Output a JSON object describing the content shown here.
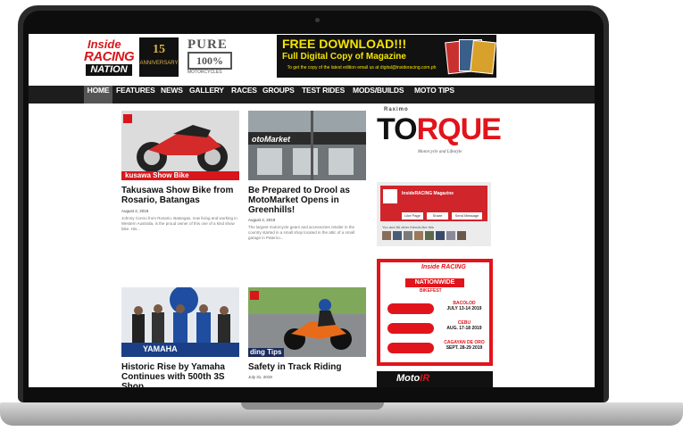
{
  "logo": {
    "line1": "Inside",
    "line2": "RACING",
    "line3": "NATION"
  },
  "anniversary": {
    "number": "15",
    "text": "ANNIVERSARY"
  },
  "pure": {
    "word": "PURE",
    "percent": "100%",
    "tagline": "MOTORCYCLES"
  },
  "banner": {
    "headline": "FREE DOWNLOAD!!!",
    "subline": "Full Digital Copy of Magazine",
    "note": "To get the copy of the latest edition email us at digital@insideracing.com.ph"
  },
  "nav": {
    "items": [
      "HOME",
      "FEATURES",
      "NEWS",
      "GALLERY",
      "RACES",
      "GROUPS",
      "TEST RIDES",
      "MODS/BUILDS",
      "MOTO TIPS"
    ],
    "active": "HOME"
  },
  "articles": [
    {
      "thumb_caption": "kusawa Show Bike",
      "title": "Takusawa Show Bike from Rosario, Batangas",
      "date": "August 2, 2019",
      "excerpt": "Johnny Corcio from Rosario, Batangas, now living and working in Western Australia, is the proud owner of this one of a kind show bike. His..."
    },
    {
      "thumb_caption": "otoMarket",
      "title": "Be Prepared to Drool as MotoMarket Opens in Greenhills!",
      "date": "August 2, 2019",
      "excerpt": "The largest motorcycle gears and accessories retailer in the country started in a small shop located in the attic of a small garage in Paterno..."
    },
    {
      "thumb_caption": "YAMAHA",
      "title": "Historic Rise by Yamaha Continues with 500th 3S Shop",
      "date": "",
      "excerpt": ""
    },
    {
      "thumb_caption": "ding Tips",
      "title": "Safety in Track Riding",
      "date": "July 31, 2019",
      "excerpt": ""
    }
  ],
  "sidebar": {
    "torque": {
      "small": "Raximo",
      "big_a": "TO",
      "big_b": "RQUE",
      "sub": "Motorcycle and Lifestyle"
    },
    "facebook": {
      "page_name": "InsideRACING Magazine",
      "likes": "",
      "like_btn": "Like Page",
      "share_btn": "Share",
      "msg_btn": "Send Message",
      "friends_text": "You and 86 other friends like this"
    },
    "bikefest": {
      "logo": "Inside RACING",
      "title": "NATIONWIDE",
      "subtitle": "BIKEFEST",
      "stops": [
        {
          "city": "BACOLOD",
          "dates": "JULY 13-14 2019"
        },
        {
          "city": "CEBU",
          "dates": "AUG. 17-18 2019"
        },
        {
          "city": "CAGAYAN DE ORO",
          "dates": "SEPT. 28-29 2019"
        }
      ]
    },
    "motoir": {
      "a": "Moto",
      "b": "IR"
    }
  }
}
